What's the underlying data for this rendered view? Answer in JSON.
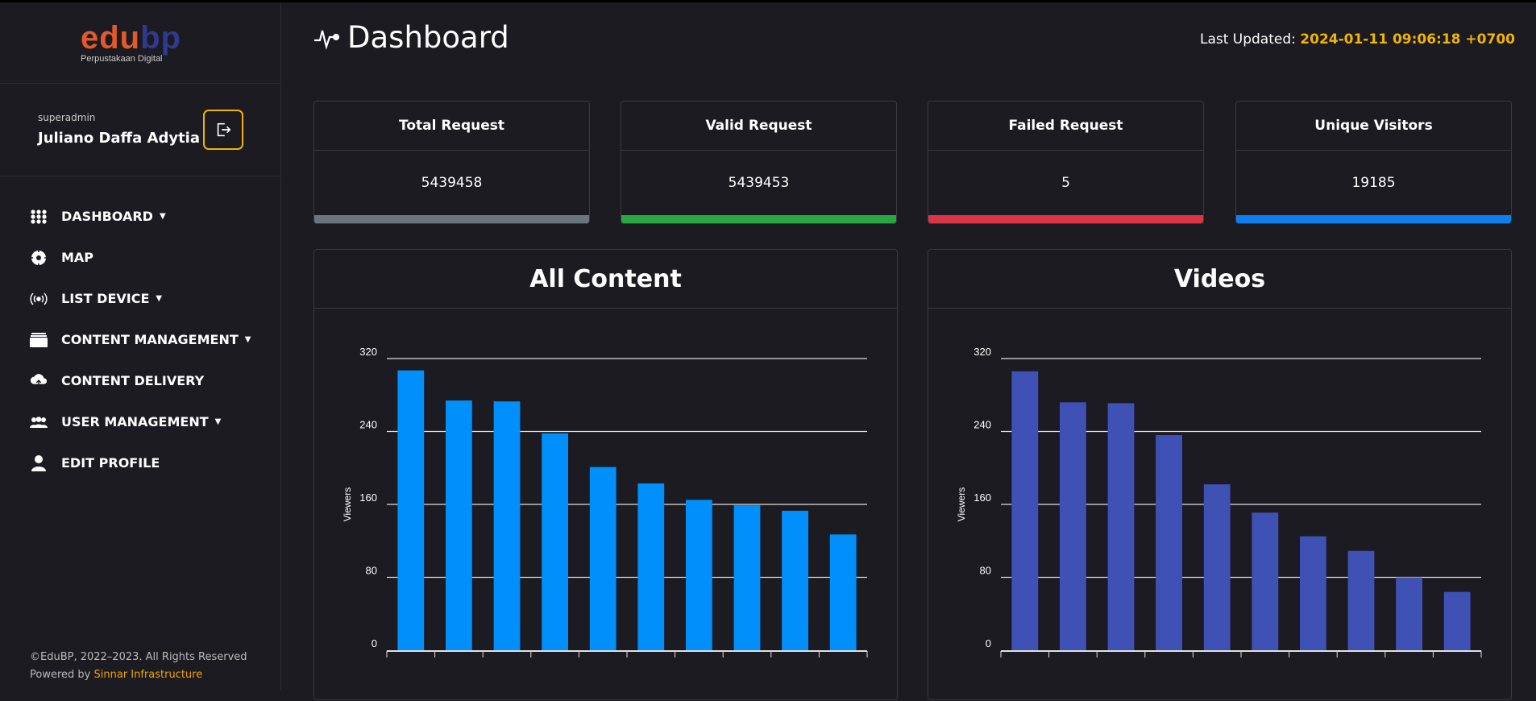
{
  "brand": {
    "logo_text_a": "edu",
    "logo_text_b": "bp",
    "tagline": "Perpustakaan Digital",
    "orange": "#e25a2c",
    "blue": "#2f3a8f"
  },
  "user": {
    "role": "superadmin",
    "name": "Juliano Daffa Adytia",
    "logout_icon": "logout-icon"
  },
  "nav": [
    {
      "label": "DASHBOARD",
      "icon": "grid-icon",
      "dropdown": true
    },
    {
      "label": "MAP",
      "icon": "map-target-icon",
      "dropdown": false
    },
    {
      "label": "LIST DEVICE",
      "icon": "broadcast-icon",
      "dropdown": true
    },
    {
      "label": "CONTENT MANAGEMENT",
      "icon": "folder-stack-icon",
      "dropdown": true
    },
    {
      "label": "CONTENT DELIVERY",
      "icon": "cloud-upload-icon",
      "dropdown": false
    },
    {
      "label": "USER MANAGEMENT",
      "icon": "users-icon",
      "dropdown": true
    },
    {
      "label": "EDIT PROFILE",
      "icon": "user-icon",
      "dropdown": false
    }
  ],
  "footer": {
    "copyright": "©EduBP, 2022–2023. All Rights Reserved",
    "powered_prefix": "Powered by ",
    "powered_link": "Sinnar Infrastructure"
  },
  "header": {
    "title": "Dashboard",
    "updated_label": "Last Updated: ",
    "updated_value": "2024-01-11 09:06:18 +0700"
  },
  "cards": [
    {
      "title": "Total Request",
      "value": "5439458",
      "color": "#6c757d"
    },
    {
      "title": "Valid Request",
      "value": "5439453",
      "color": "#28a745"
    },
    {
      "title": "Failed Request",
      "value": "5",
      "color": "#dc3545"
    },
    {
      "title": "Unique Visitors",
      "value": "19185",
      "color": "#0d7ff0"
    }
  ],
  "chart_data": [
    {
      "type": "bar",
      "title": "All Content",
      "ylabel": "Viewers",
      "ylim": [
        0,
        320
      ],
      "yticks": [
        0,
        80,
        160,
        240,
        320
      ],
      "grid": true,
      "color": "#008ffb",
      "values": [
        307,
        274,
        273,
        238,
        201,
        183,
        165,
        159,
        153,
        127
      ]
    },
    {
      "type": "bar",
      "title": "Videos",
      "ylabel": "Viewers",
      "ylim": [
        0,
        320
      ],
      "yticks": [
        0,
        80,
        160,
        240,
        320
      ],
      "grid": true,
      "color": "#3f51b5",
      "values": [
        306,
        272,
        271,
        236,
        182,
        151,
        125,
        109,
        80,
        64
      ]
    }
  ]
}
